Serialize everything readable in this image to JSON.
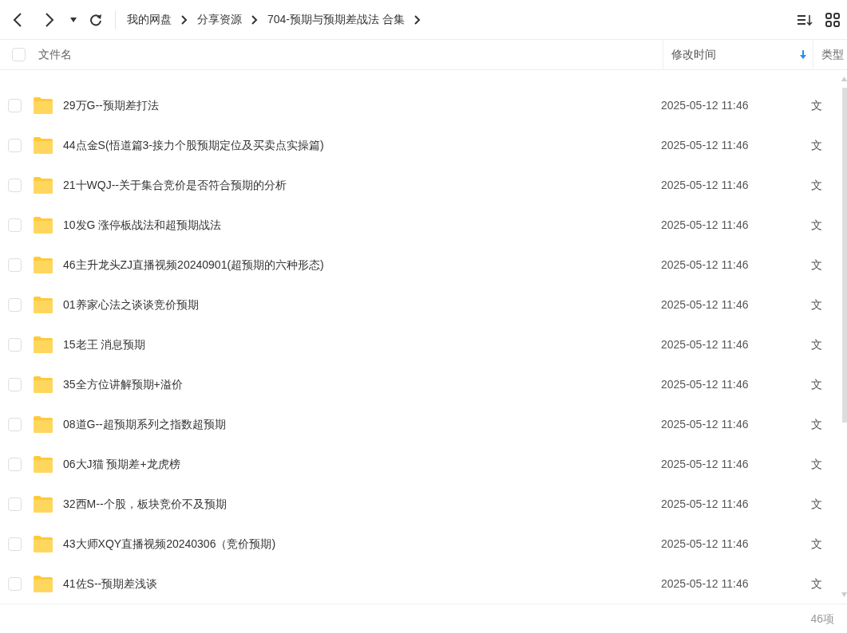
{
  "breadcrumb": [
    "我的网盘",
    "分享资源",
    "704-预期与预期差战法 合集"
  ],
  "table": {
    "select_all_checked": false,
    "columns": [
      {
        "label": "文件名",
        "sorted": false
      },
      {
        "label": "修改时间",
        "sorted": true
      },
      {
        "label": "类型",
        "sorted": false
      }
    ],
    "rows": [
      {
        "name": "29万G--预期差打法",
        "modified": "2025-05-12 11:46",
        "type": "文",
        "checked": false
      },
      {
        "name": "44点金S(悟道篇3-接力个股预期定位及买卖点实操篇)",
        "modified": "2025-05-12 11:46",
        "type": "文",
        "checked": false
      },
      {
        "name": "21十WQJ--关于集合竞价是否符合预期的分析",
        "modified": "2025-05-12 11:46",
        "type": "文",
        "checked": false
      },
      {
        "name": "10发G 涨停板战法和超预期战法",
        "modified": "2025-05-12 11:46",
        "type": "文",
        "checked": false
      },
      {
        "name": "46主升龙头ZJ直播视频20240901(超预期的六种形态)",
        "modified": "2025-05-12 11:46",
        "type": "文",
        "checked": false
      },
      {
        "name": "01养家心法之谈谈竞价预期",
        "modified": "2025-05-12 11:46",
        "type": "文",
        "checked": false
      },
      {
        "name": "15老王 消息预期",
        "modified": "2025-05-12 11:46",
        "type": "文",
        "checked": false
      },
      {
        "name": "35全方位讲解预期+溢价",
        "modified": "2025-05-12 11:46",
        "type": "文",
        "checked": false
      },
      {
        "name": "08道G--超预期系列之指数超预期",
        "modified": "2025-05-12 11:46",
        "type": "文",
        "checked": false
      },
      {
        "name": "06大J猫 预期差+龙虎榜",
        "modified": "2025-05-12 11:46",
        "type": "文",
        "checked": false
      },
      {
        "name": "32西M--个股，板块竞价不及预期",
        "modified": "2025-05-12 11:46",
        "type": "文",
        "checked": false
      },
      {
        "name": "43大师XQY直播视频20240306（竞价预期)",
        "modified": "2025-05-12 11:46",
        "type": "文",
        "checked": false
      },
      {
        "name": "41佐S--预期差浅谈",
        "modified": "2025-05-12 11:46",
        "type": "文",
        "checked": false
      }
    ]
  },
  "status_bar": {
    "count": "46项"
  }
}
